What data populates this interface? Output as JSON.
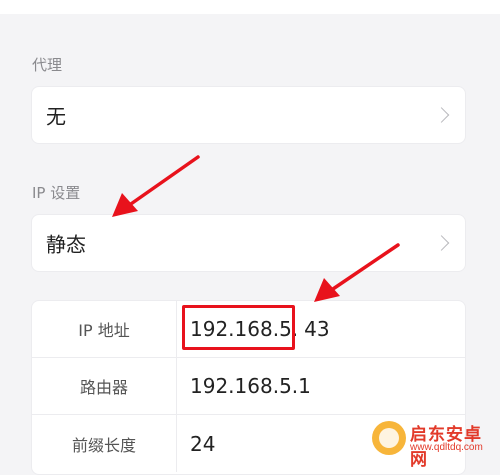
{
  "proxy": {
    "section_label": "代理",
    "value": "无"
  },
  "ip_settings": {
    "section_label": "IP 设置",
    "value": "静态"
  },
  "ip_table": {
    "rows": [
      {
        "label": "IP 地址",
        "value_prefix": "192.168.5.",
        "value_suffix": "43"
      },
      {
        "label": "路由器",
        "value": "192.168.5.1"
      },
      {
        "label": "前缀长度",
        "value": "24"
      }
    ]
  },
  "watermark": {
    "title": "启东安卓网",
    "url": "www.qdltdq.com"
  },
  "colors": {
    "background": "#f4f4f6",
    "card": "#ffffff",
    "annotation_red": "#e8121c",
    "label_gray": "#8a8a8e",
    "watermark_orange": "#f7b53a"
  },
  "icons": {
    "row_chevron": "chevron-right-icon",
    "annotation": "arrow-icon"
  }
}
